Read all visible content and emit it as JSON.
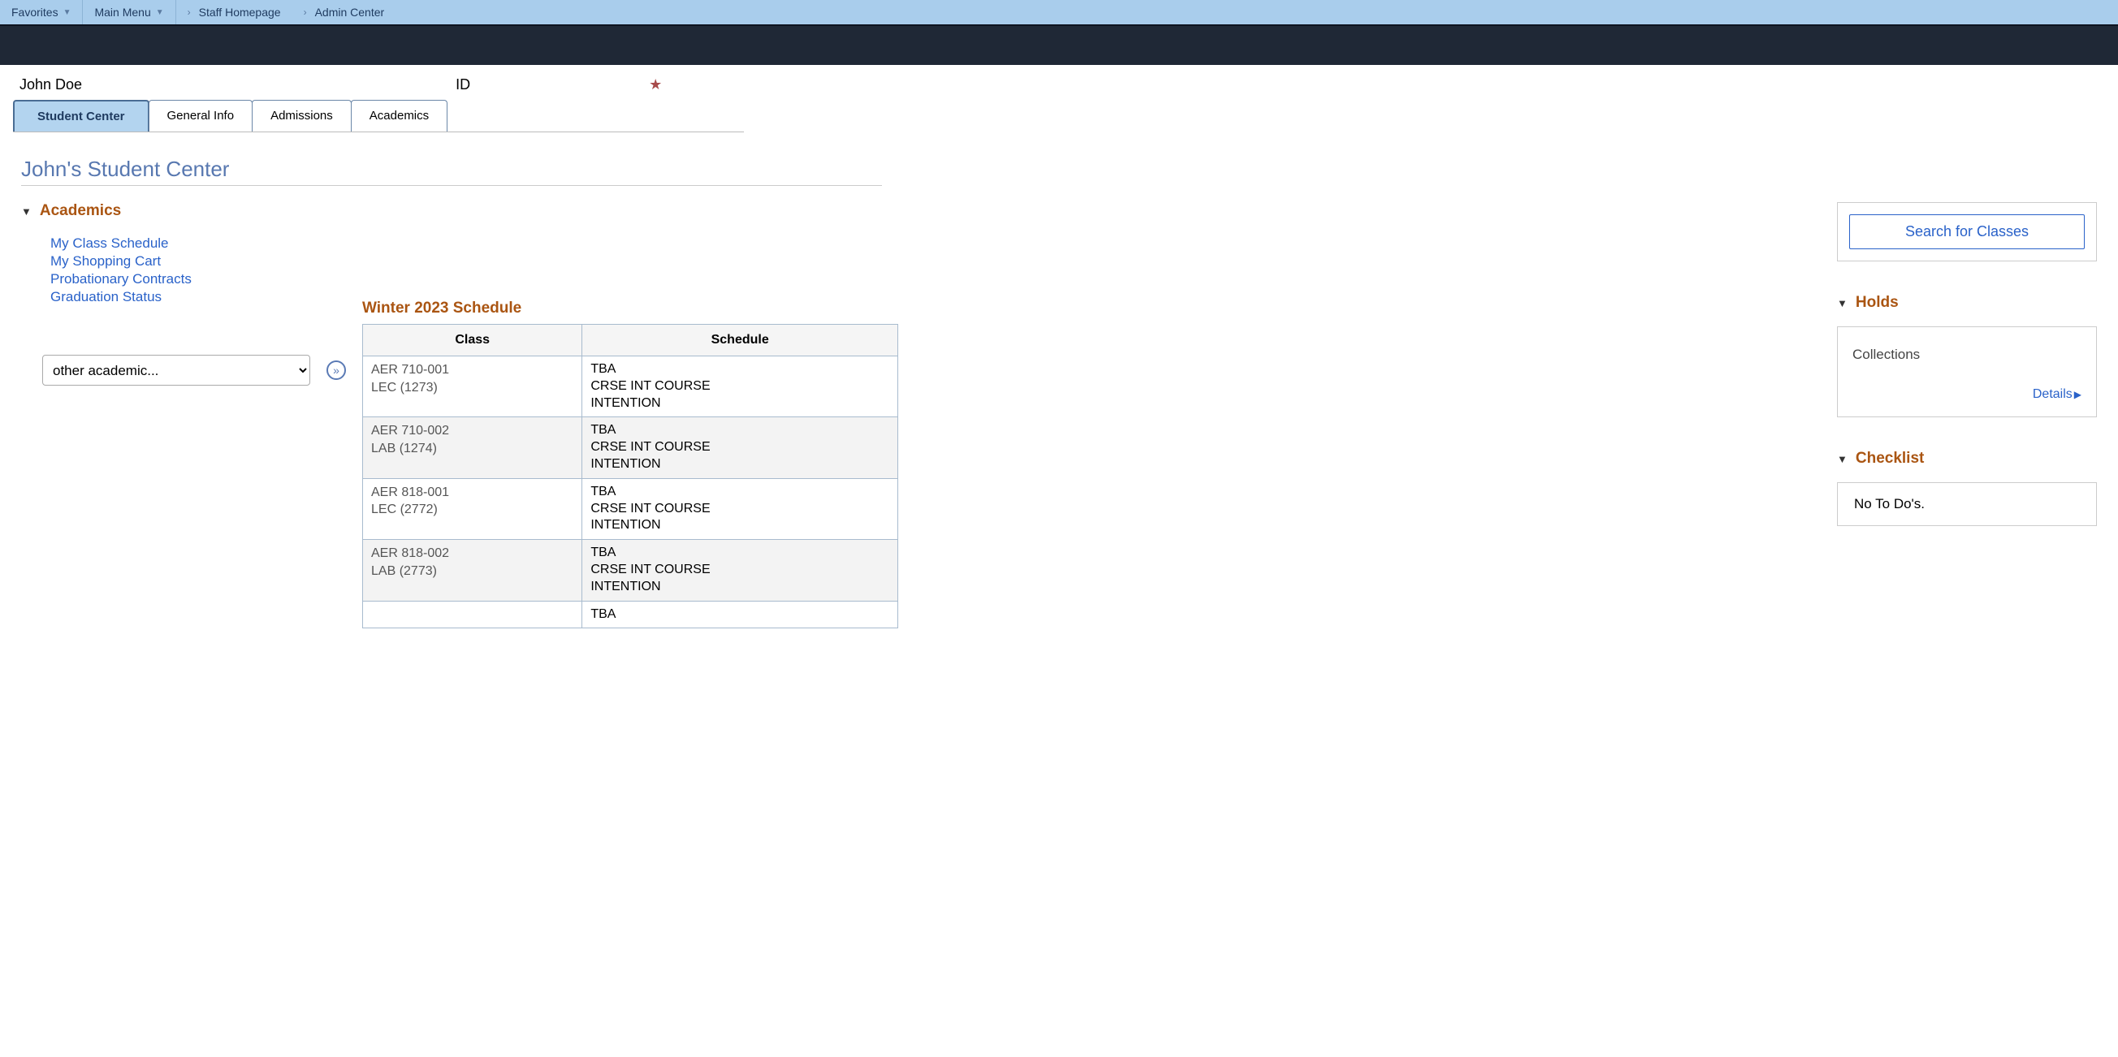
{
  "breadcrumb": {
    "favorites": "Favorites",
    "main_menu": "Main Menu",
    "staff_homepage": "Staff Homepage",
    "admin_center": "Admin Center"
  },
  "identity": {
    "name": "John Doe",
    "id_label": "ID"
  },
  "tabs": {
    "student_center": "Student Center",
    "general_info": "General Info",
    "admissions": "Admissions",
    "academics": "Academics"
  },
  "page_title": "John's Student Center",
  "academics": {
    "title": "Academics",
    "links": {
      "class_schedule": "My Class Schedule",
      "shopping_cart": "My Shopping Cart",
      "probationary": "Probationary Contracts",
      "graduation": "Graduation Status"
    },
    "select_placeholder": "other academic..."
  },
  "schedule": {
    "title": "Winter 2023 Schedule",
    "header_class": "Class",
    "header_schedule": "Schedule",
    "rows": [
      {
        "class_line1": "AER 710-001",
        "class_line2": "LEC (1273)",
        "sched_line1": "TBA",
        "sched_line2": "CRSE INT COURSE",
        "sched_line3": "INTENTION"
      },
      {
        "class_line1": "AER 710-002",
        "class_line2": "LAB (1274)",
        "sched_line1": "TBA",
        "sched_line2": "CRSE INT COURSE",
        "sched_line3": "INTENTION"
      },
      {
        "class_line1": "AER 818-001",
        "class_line2": "LEC (2772)",
        "sched_line1": "TBA",
        "sched_line2": "CRSE INT COURSE",
        "sched_line3": "INTENTION"
      },
      {
        "class_line1": "AER 818-002",
        "class_line2": "LAB (2773)",
        "sched_line1": "TBA",
        "sched_line2": "CRSE INT COURSE",
        "sched_line3": "INTENTION"
      },
      {
        "class_line1": "",
        "class_line2": "",
        "sched_line1": "TBA",
        "sched_line2": "",
        "sched_line3": ""
      }
    ]
  },
  "right": {
    "search_label": "Search for Classes",
    "holds_title": "Holds",
    "holds_text": "Collections",
    "details_label": "Details",
    "checklist_title": "Checklist",
    "checklist_text": "No To Do's."
  }
}
